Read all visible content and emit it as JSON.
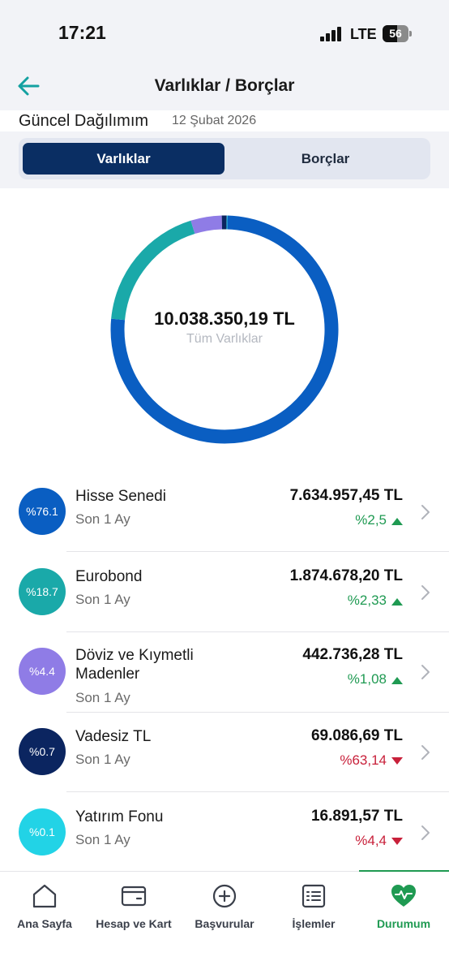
{
  "status_bar": {
    "time": "17:21",
    "network": "LTE",
    "battery": "56",
    "battery_level": 0.56
  },
  "header": {
    "title": "Varlıklar / Borçlar"
  },
  "distribution": {
    "label": "Güncel Dağılımım",
    "date": "12 Şubat 2026"
  },
  "segments": {
    "active": "Varlıklar",
    "inactive": "Borçlar"
  },
  "donut": {
    "total": "10.038.350,19 TL",
    "subtitle": "Tüm Varlıklar",
    "slices": [
      {
        "value": 76.1,
        "color": "#0a5ec2"
      },
      {
        "value": 18.7,
        "color": "#1aa9a9"
      },
      {
        "value": 4.4,
        "color": "#8f7ce6"
      },
      {
        "value": 0.7,
        "color": "#0b2560"
      },
      {
        "value": 0.1,
        "color": "#22d3e6"
      }
    ]
  },
  "assets": [
    {
      "percent": "%76.1",
      "name": "Hisse Senedi",
      "period": "Son 1 Ay",
      "amount": "7.634.957,45 TL",
      "change": "%2,5",
      "direction": "up",
      "color": "#0a5ec2"
    },
    {
      "percent": "%18.7",
      "name": "Eurobond",
      "period": "Son 1 Ay",
      "amount": "1.874.678,20 TL",
      "change": "%2,33",
      "direction": "up",
      "color": "#1aa9a9"
    },
    {
      "percent": "%4.4",
      "name": "Döviz ve Kıymetli Madenler",
      "period": "Son 1 Ay",
      "amount": "442.736,28 TL",
      "change": "%1,08",
      "direction": "up",
      "color": "#8f7ce6"
    },
    {
      "percent": "%0.7",
      "name": "Vadesiz TL",
      "period": "Son 1 Ay",
      "amount": "69.086,69 TL",
      "change": "%63,14",
      "direction": "down",
      "color": "#0b2560"
    },
    {
      "percent": "%0.1",
      "name": "Yatırım Fonu",
      "period": "Son 1 Ay",
      "amount": "16.891,57 TL",
      "change": "%4,4",
      "direction": "down",
      "color": "#22d3e6"
    }
  ],
  "colors": {
    "up": "#1f9a52",
    "down": "#c8203a",
    "accent": "#0a2e63",
    "tab_active": "#1f9a52"
  },
  "tabs": [
    {
      "label": "Ana Sayfa",
      "icon": "home-icon"
    },
    {
      "label": "Hesap ve Kart",
      "icon": "wallet-icon"
    },
    {
      "label": "Başvurular",
      "icon": "plus-circle-icon"
    },
    {
      "label": "İşlemler",
      "icon": "list-icon"
    },
    {
      "label": "Durumum",
      "icon": "heart-pulse-icon",
      "active": true
    }
  ]
}
